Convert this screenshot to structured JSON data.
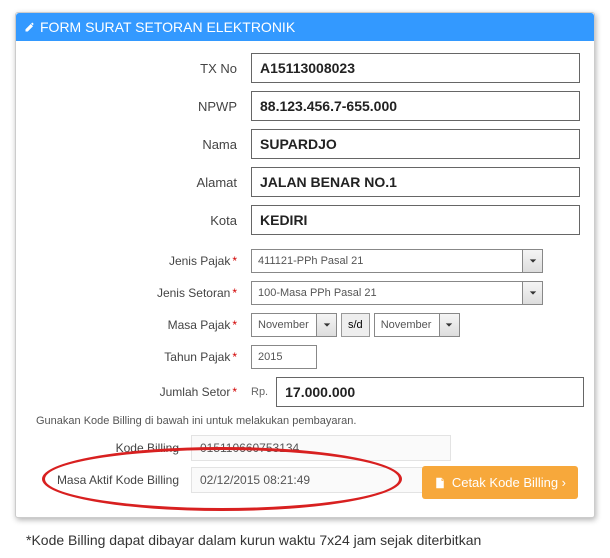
{
  "panel": {
    "title": "FORM SURAT SETORAN ELEKTRONIK"
  },
  "form": {
    "tx_no": {
      "label": "TX No",
      "value": "A15113008023"
    },
    "npwp": {
      "label": "NPWP",
      "value": "88.123.456.7-655.000"
    },
    "nama": {
      "label": "Nama",
      "value": "SUPARDJO"
    },
    "alamat": {
      "label": "Alamat",
      "value": "JALAN BENAR NO.1"
    },
    "kota": {
      "label": "Kota",
      "value": "KEDIRI"
    },
    "jenis_pajak": {
      "label": "Jenis Pajak",
      "value": "411121-PPh Pasal 21"
    },
    "jenis_setoran": {
      "label": "Jenis Setoran",
      "value": "100-Masa PPh Pasal 21"
    },
    "masa_pajak": {
      "label": "Masa Pajak",
      "from": "November",
      "separator": "s/d",
      "to": "November"
    },
    "tahun_pajak": {
      "label": "Tahun Pajak",
      "value": "2015"
    },
    "jumlah_setor": {
      "label": "Jumlah Setor",
      "prefix": "Rp.",
      "value": "17.000.000"
    }
  },
  "hint": "Gunakan Kode Billing di bawah ini untuk melakukan pembayaran.",
  "billing": {
    "kode": {
      "label": "Kode Billing",
      "value": "015110660753134"
    },
    "masa_aktif": {
      "label": "Masa Aktif Kode Billing",
      "value": "02/12/2015 08:21:49"
    }
  },
  "cetak_button": "Cetak Kode Billing ›",
  "footnote": "*Kode Billing dapat dibayar dalam kurun waktu 7x24 jam  sejak diterbitkan"
}
